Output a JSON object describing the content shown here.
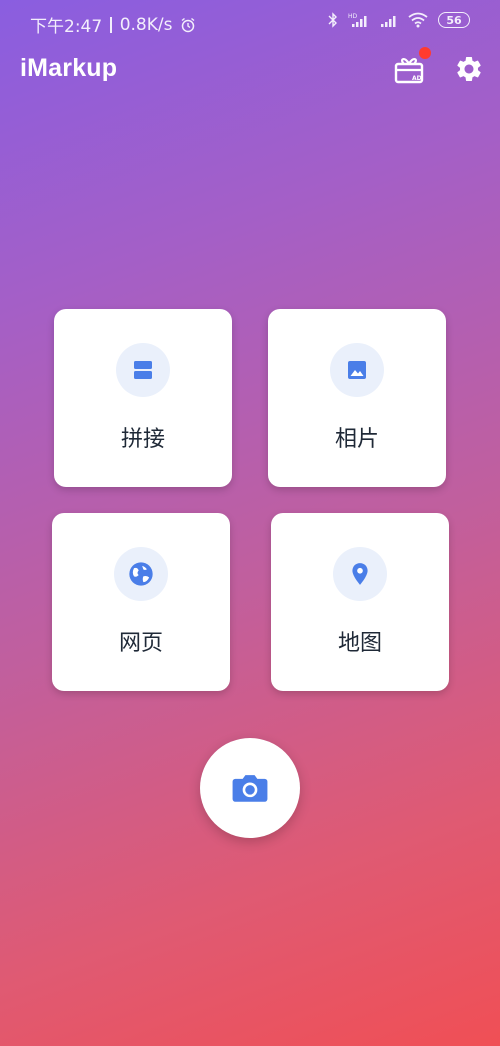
{
  "status_bar": {
    "time": "下午2:47",
    "speed": "0.8K/s",
    "battery": "56"
  },
  "app_bar": {
    "title": "iMarkup"
  },
  "cards": {
    "stitch": {
      "label": "拼接",
      "icon": "stitch-icon"
    },
    "photo": {
      "label": "相片",
      "icon": "image-icon"
    },
    "web": {
      "label": "网页",
      "icon": "globe-icon"
    },
    "map": {
      "label": "地图",
      "icon": "location-pin-icon"
    }
  },
  "camera": {
    "icon": "camera-icon"
  },
  "colors": {
    "accent": "#4a7ee8",
    "icon_bg": "#eaf0fb",
    "badge": "#ff3b30",
    "gradient_top": "#8a5ee0",
    "gradient_bottom": "#f04f55"
  }
}
